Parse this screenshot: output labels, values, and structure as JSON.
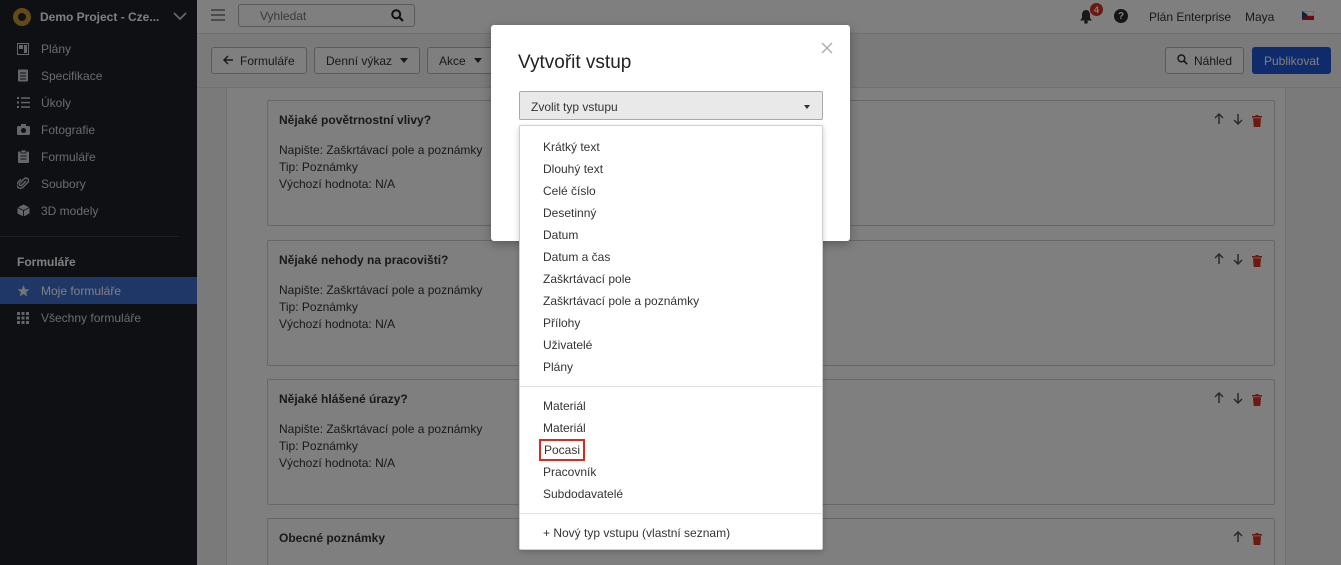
{
  "sidebar": {
    "project": "Demo Project - Cze...",
    "items": [
      {
        "label": "Plány",
        "icon": "plans-icon"
      },
      {
        "label": "Specifikace",
        "icon": "specifications-icon"
      },
      {
        "label": "Úkoly",
        "icon": "tasks-icon"
      },
      {
        "label": "Fotografie",
        "icon": "camera-icon"
      },
      {
        "label": "Formuláře",
        "icon": "clipboard-icon"
      },
      {
        "label": "Soubory",
        "icon": "paperclip-icon"
      },
      {
        "label": "3D modely",
        "icon": "cube-icon"
      }
    ],
    "section_title": "Formuláře",
    "section_items": [
      {
        "label": "Moje formuláře",
        "icon": "star-icon",
        "active": true
      },
      {
        "label": "Všechny formuláře",
        "icon": "grid-icon",
        "active": false
      }
    ]
  },
  "topbar": {
    "search_placeholder": "Vyhledat",
    "notifications": "4",
    "help": "?",
    "plan": "Plán Enterprise",
    "user": "Maya"
  },
  "toolbar": {
    "back": "Formuláře",
    "daily_report": "Denní výkaz",
    "actions": "Akce",
    "preview": "Náhled",
    "publish": "Publikovat"
  },
  "cards": [
    {
      "title": "Nějaké povětrnostní vlivy?",
      "lines": [
        "Napište: Zaškrtávací pole a poznámky",
        "Tip: Poznámky",
        "Výchozí hodnota: N/A"
      ]
    },
    {
      "title": "Nějaké nehody na pracovišti?",
      "lines": [
        "Napište: Zaškrtávací pole a poznámky",
        "Tip: Poznámky",
        "Výchozí hodnota: N/A"
      ]
    },
    {
      "title": "Nějaké hlášené úrazy?",
      "lines": [
        "Napište: Zaškrtávací pole a poznámky",
        "Tip: Poznámky",
        "Výchozí hodnota: N/A"
      ]
    },
    {
      "title": "Obecné poznámky",
      "lines": []
    }
  ],
  "modal": {
    "title": "Vytvořit vstup",
    "select_placeholder": "Zvolit typ vstupu",
    "options_group1": [
      "Krátký text",
      "Dlouhý text",
      "Celé číslo",
      "Desetinný",
      "Datum",
      "Datum a čas",
      "Zaškrtávací pole",
      "Zaškrtávací pole a poznámky",
      "Přílohy",
      "Uživatelé",
      "Plány"
    ],
    "options_group2": [
      "Materiál",
      "Materiál",
      "Pocasi",
      "Pracovník",
      "Subdodavatelé"
    ],
    "new_type": "+ Nový typ vstupu (vlastní seznam)"
  },
  "colors": {
    "accent": "#1f57d6",
    "sidebar_bg": "#1e2127",
    "active_item": "#3f6fcf",
    "highlight": "#e0291b",
    "danger": "#d9321f"
  }
}
